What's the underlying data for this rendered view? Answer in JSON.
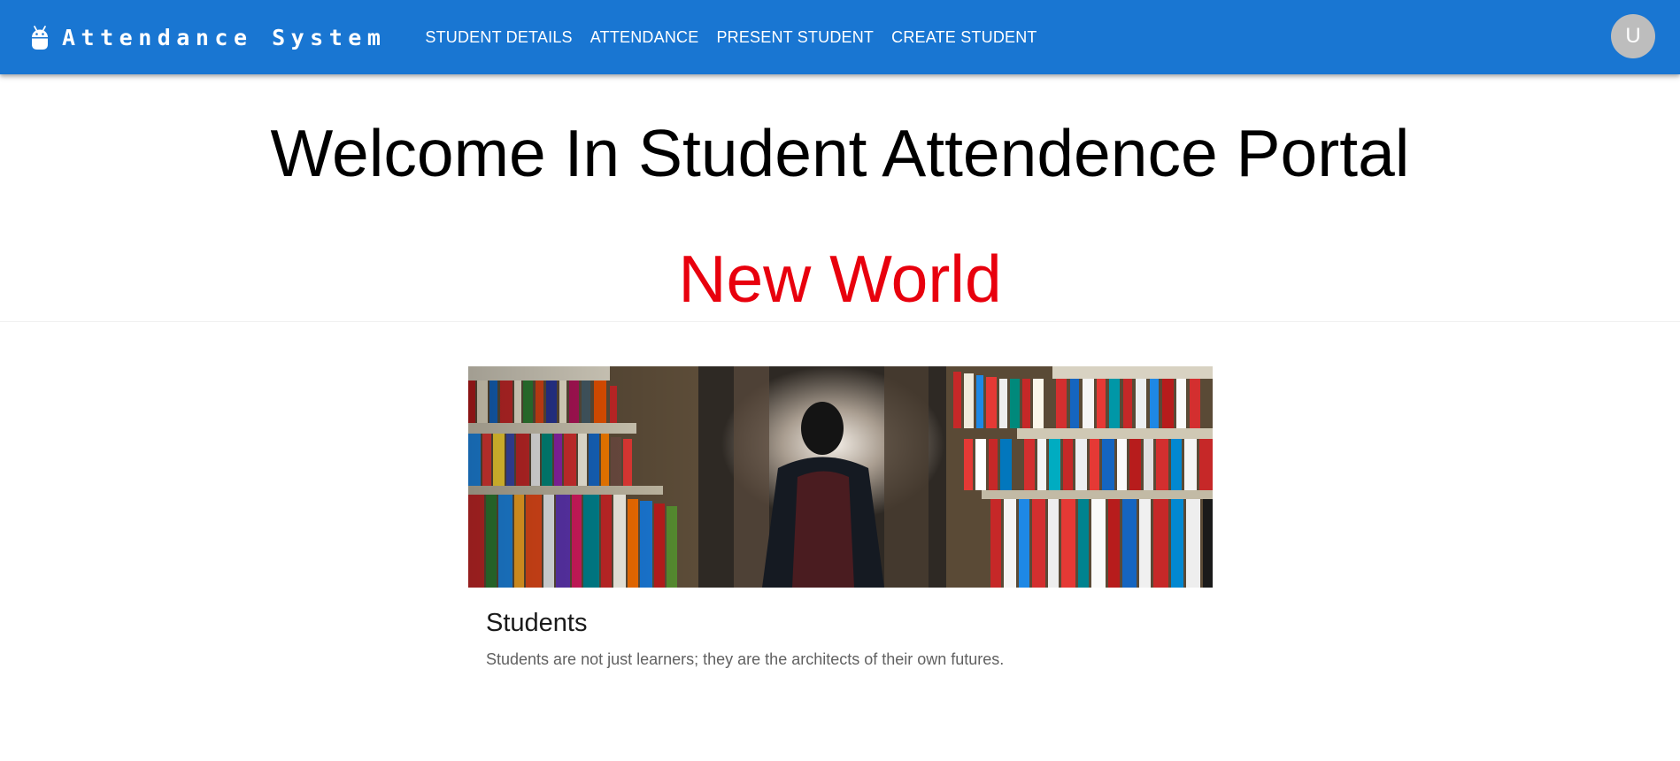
{
  "header": {
    "brand": "Attendance System",
    "nav": [
      "STUDENT DETAILS",
      "ATTENDANCE",
      "PRESENT STUDENT",
      "CREATE STUDENT"
    ],
    "avatar_initial": "U",
    "colors": {
      "appbar": "#1976d2",
      "avatar": "#bdbdbd"
    }
  },
  "hero": {
    "title": "Welcome In Student Attendence Portal",
    "subtitle": "New World",
    "subtitle_color": "#e8000d"
  },
  "card": {
    "image": "library-bookshelves-photo",
    "title": "Students",
    "text": "Students are not just learners; they are the architects of their own futures."
  }
}
